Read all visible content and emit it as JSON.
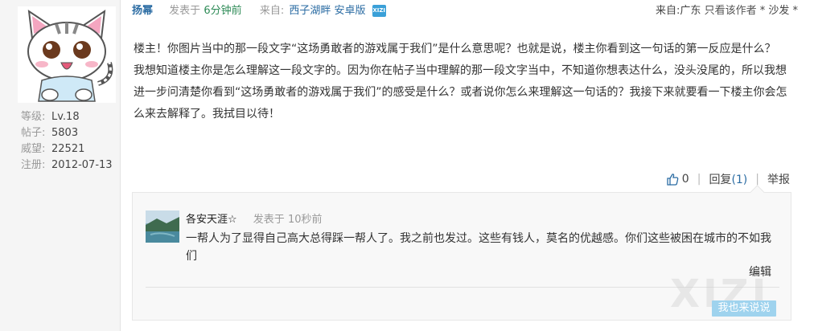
{
  "author_panel": {
    "stats": [
      {
        "label": "等级:",
        "value": "Lv.18"
      },
      {
        "label": "帖子:",
        "value": "5803"
      },
      {
        "label": "威望:",
        "value": "22521"
      },
      {
        "label": "注册:",
        "value": "2012-07-13"
      }
    ]
  },
  "post": {
    "author": "扬幂",
    "posted_label": "发表于",
    "posted_time": "6分钟前",
    "source_label": "来自:",
    "source_name": "西子湖畔 安卓版",
    "badge_text": "XIZI",
    "location": "来自:广东",
    "only_author": "只看该作者",
    "floor_tag": "* 沙发 *",
    "body_lines": [
      "楼主！你图片当中的那一段文字“这场勇敢者的游戏属于我们”是什么意思呢？也就是说，楼主你看到这一句话的第一反应是什么？",
      "我想知道楼主你是怎么理解这一段文字的。因为你在帖子当中理解的那一段文字当中，不知道你想表达什么，没头没尾的，所以我想",
      "进一步问清楚你看到“这场勇敢者的游戏属于我们”的感受是什么？或者说你怎么来理解这一句话的？我接下来就要看一下楼主你会怎",
      "么来去解释了。我拭目以待！"
    ],
    "actions": {
      "like_count": "0",
      "reply_label": "回复",
      "reply_count": "(1)",
      "report_label": "举报"
    }
  },
  "reply": {
    "author": "各安天涯☆",
    "posted_label": "发表于",
    "posted_time": "10秒前",
    "text": "一帮人为了显得自己高大总得踩一帮人了。我之前也发过。这些有钱人，莫名的优越感。你们这些被困在城市的不如我们",
    "edit_label": "编辑",
    "watermark": "XIZI",
    "reply_button": "我也来说说"
  },
  "colors": {
    "link": "#2b6ca3",
    "time": "#2e8b57",
    "badge": "#3aa0d8",
    "reply_button": "#9fd3ee"
  }
}
